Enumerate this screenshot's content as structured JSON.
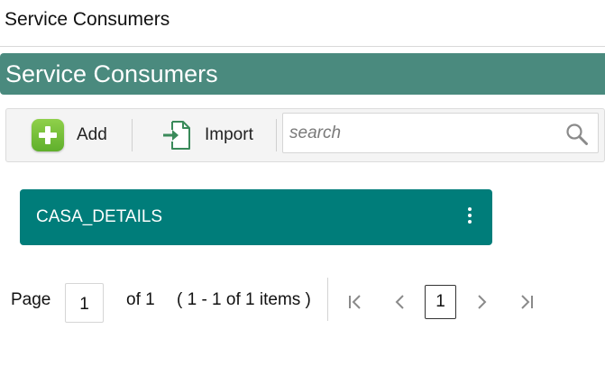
{
  "header": {
    "title": "Service Consumers"
  },
  "banner": {
    "title": "Service Consumers"
  },
  "toolbar": {
    "add_label": "Add",
    "import_label": "Import",
    "search_placeholder": "search",
    "search_value": ""
  },
  "cards": [
    {
      "name": "CASA_DETAILS"
    }
  ],
  "pagination": {
    "page_label": "Page",
    "current_page": "1",
    "of_label": "of 1",
    "items_summary": "( 1 - 1 of 1 items )",
    "page_button": "1"
  },
  "icons": {
    "add": "plus-icon",
    "import": "import-icon",
    "search": "magnifier-icon",
    "card_menu": "kebab-menu-icon",
    "first": "first-page-icon",
    "prev": "previous-page-icon",
    "next": "next-page-icon",
    "last": "last-page-icon"
  },
  "colors": {
    "banner": "#4a8a7e",
    "card": "#007d7a",
    "add_icon": "#6dbb35",
    "import_icon": "#3a8a5a"
  }
}
